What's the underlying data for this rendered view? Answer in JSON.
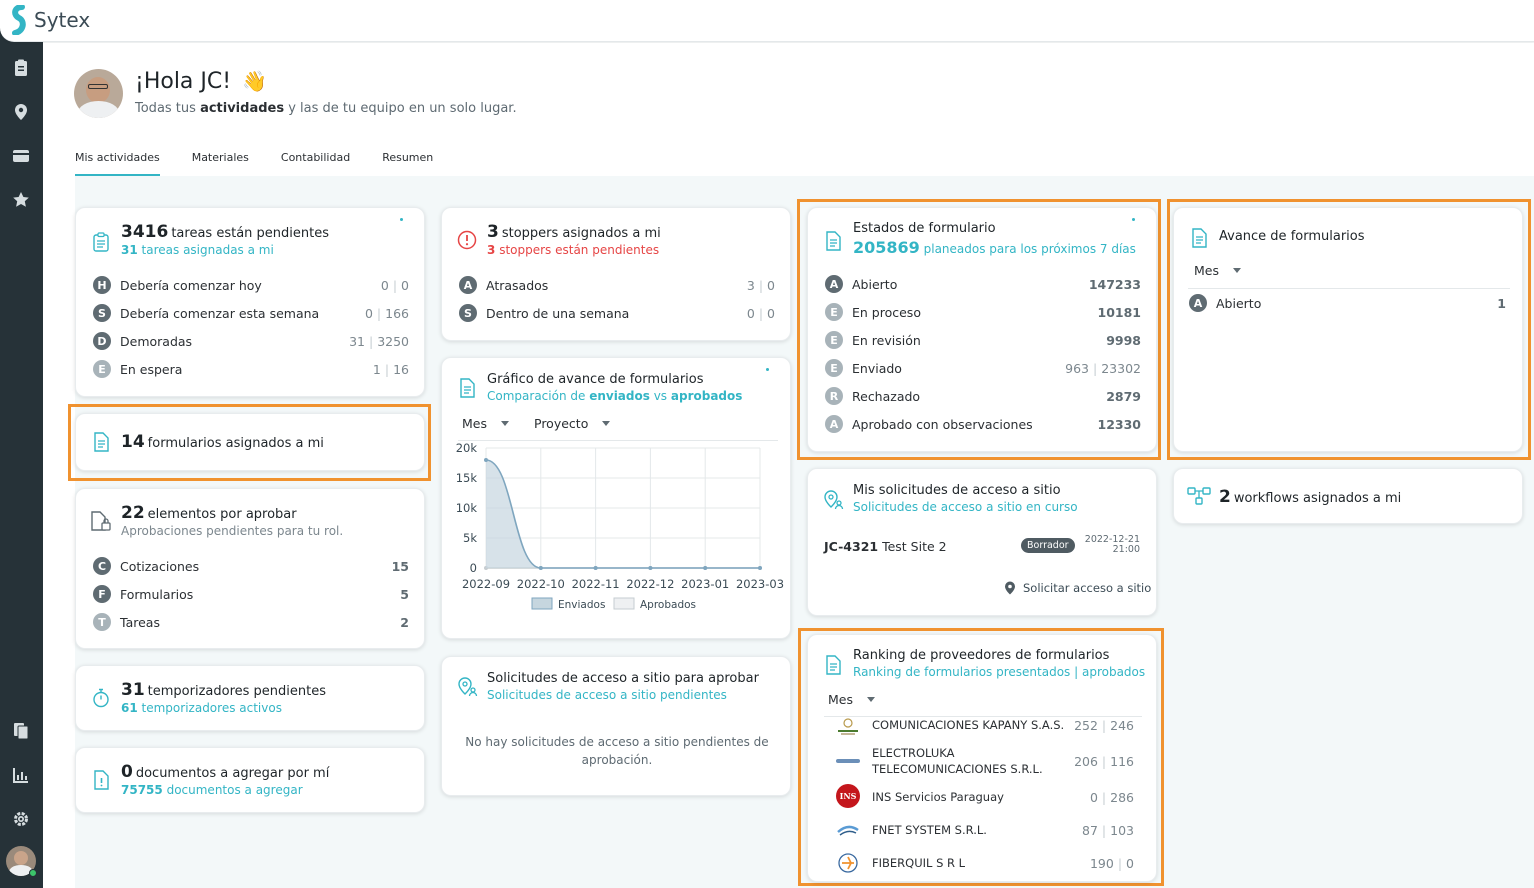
{
  "app": {
    "brand": "Sytex",
    "brand_color": "#33b5c5",
    "highlight_color": "#f0922f"
  },
  "sidebar": {
    "icons": [
      "clipboard-icon",
      "map-pin-icon",
      "wallet-icon",
      "star-icon",
      "documents-icon",
      "chart-icon",
      "gear-icon",
      "user-avatar"
    ]
  },
  "header": {
    "greeting": "¡Hola JC!",
    "wave": "👋",
    "sub_pre": "Todas tus ",
    "sub_bold": "actividades",
    "sub_post": " y las de tu equipo en un solo lugar."
  },
  "tabs": [
    "Mis actividades",
    "Materiales",
    "Contabilidad",
    "Resumen"
  ],
  "tareas": {
    "count": "3416",
    "title": "tareas están pendientes",
    "sub_count": "31",
    "sub_text": "tareas asignadas a mi",
    "rows": [
      {
        "letter": "H",
        "label": "Debería comenzar hoy",
        "a": "0",
        "b": "0"
      },
      {
        "letter": "S",
        "label": "Debería comenzar esta semana",
        "a": "0",
        "b": "166"
      },
      {
        "letter": "D",
        "label": "Demoradas",
        "a": "31",
        "b": "3250"
      },
      {
        "letter": "E",
        "label": "En espera",
        "a": "1",
        "b": "16"
      }
    ]
  },
  "formularios_asignados": {
    "count": "14",
    "title": "formularios asignados a mi"
  },
  "elementos": {
    "count": "22",
    "title": "elementos por aprobar",
    "sub": "Aprobaciones pendientes para tu rol.",
    "rows": [
      {
        "letter": "C",
        "label": "Cotizaciones",
        "value": "15"
      },
      {
        "letter": "F",
        "label": "Formularios",
        "value": "5"
      },
      {
        "letter": "T",
        "label": "Tareas",
        "value": "2"
      }
    ]
  },
  "temporizadores": {
    "count": "31",
    "title": "temporizadores pendientes",
    "sub_count": "61",
    "sub_text": "temporizadores activos"
  },
  "documentos": {
    "count": "0",
    "title": "documentos a agregar por mí",
    "sub_count": "75755",
    "sub_text": "documentos a agregar"
  },
  "stoppers": {
    "count": "3",
    "title": "stoppers asignados a mi",
    "sub_count": "3",
    "sub_text": "stoppers están pendientes",
    "rows": [
      {
        "letter": "A",
        "label": "Atrasados",
        "a": "3",
        "b": "0"
      },
      {
        "letter": "S",
        "label": "Dentro de una semana",
        "a": "0",
        "b": "0"
      }
    ]
  },
  "grafico": {
    "title": "Gráfico de avance de formularios",
    "sub_pre": "Comparación de ",
    "sub_b1": "enviados",
    "sub_mid": " vs ",
    "sub_b2": "aprobados",
    "filter1": "Mes",
    "filter2": "Proyecto"
  },
  "chart_data": {
    "type": "area",
    "x": [
      "2022-09",
      "2022-10",
      "2022-11",
      "2022-12",
      "2023-01",
      "2023-03"
    ],
    "series": [
      {
        "name": "Enviados",
        "values": [
          18000,
          0,
          0,
          0,
          0,
          0
        ]
      },
      {
        "name": "Aprobados",
        "values": [
          0,
          0,
          0,
          0,
          0,
          0
        ]
      }
    ],
    "y_ticks": [
      "0",
      "5k",
      "10k",
      "15k",
      "20k"
    ],
    "ylim": [
      0,
      20000
    ],
    "grid": true,
    "legend": "bottom"
  },
  "solicitudes_aprobar": {
    "title": "Solicitudes de acceso a sitio para aprobar",
    "sub": "Solicitudes de acceso a sitio pendientes",
    "empty": "No hay solicitudes de acceso a sitio pendientes de aprobación."
  },
  "estados": {
    "title": "Estados de formulario",
    "sub_count": "205869",
    "sub_text": "planeados para los próximos 7 días",
    "rows": [
      {
        "letter": "A",
        "label": "Abierto",
        "a": "",
        "b": "147233"
      },
      {
        "letter": "E",
        "label": "En proceso",
        "a": "",
        "b": "10181"
      },
      {
        "letter": "E",
        "label": "En revisión",
        "a": "",
        "b": "9998"
      },
      {
        "letter": "E",
        "label": "Enviado",
        "a": "963",
        "b": "23302"
      },
      {
        "letter": "R",
        "label": "Rechazado",
        "a": "",
        "b": "2879"
      },
      {
        "letter": "A",
        "label": "Aprobado con observaciones",
        "a": "",
        "b": "12330"
      }
    ]
  },
  "mis_solicitudes": {
    "title": "Mis solicitudes de acceso a sitio",
    "sub": "Solicitudes de acceso a sitio en curso",
    "code": "JC-4321",
    "site": "Test Site 2",
    "status": "Borrador",
    "date": "2022-12-21",
    "time": "21:00",
    "action": "Solicitar acceso a sitio"
  },
  "ranking": {
    "title": "Ranking de proveedores de formularios",
    "sub": "Ranking de formularios presentados | aprobados",
    "filter": "Mes",
    "rows": [
      {
        "name": "COMUNICACIONES KAPANY S.A.S.",
        "a": "252",
        "b": "246"
      },
      {
        "name": "ELECTROLUKA TELECOMUNICACIONES S.R.L.",
        "a": "206",
        "b": "116"
      },
      {
        "name": "INS Servicios Paraguay",
        "a": "0",
        "b": "286"
      },
      {
        "name": "FNET SYSTEM S.R.L.",
        "a": "87",
        "b": "103"
      },
      {
        "name": "FIBERQUIL S R L",
        "a": "190",
        "b": "0"
      }
    ],
    "ins_logo_text": "INS"
  },
  "avance": {
    "title": "Avance de formularios",
    "filter": "Mes",
    "row": {
      "letter": "A",
      "label": "Abierto",
      "value": "1"
    }
  },
  "workflows": {
    "count": "2",
    "title": "workflows asignados a mi"
  }
}
